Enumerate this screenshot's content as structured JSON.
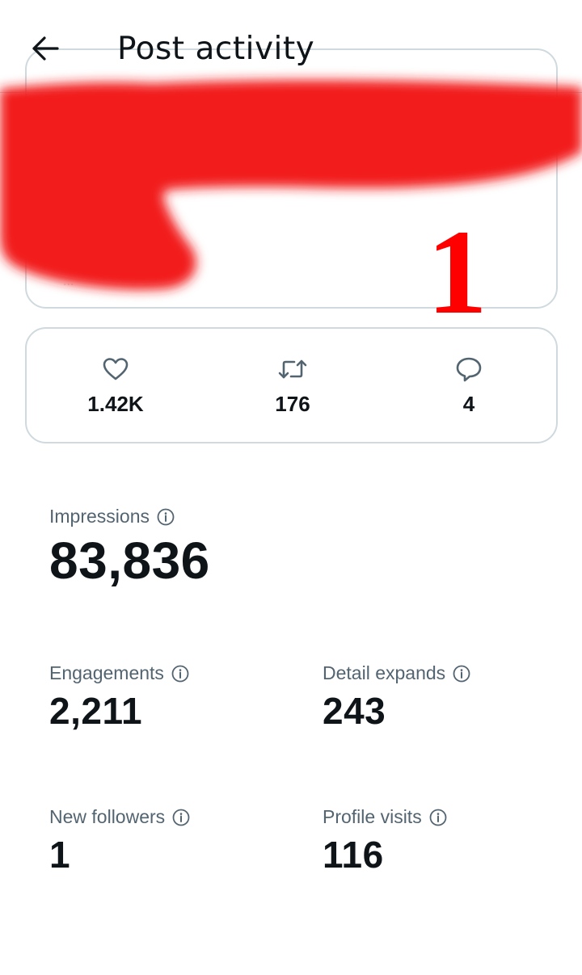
{
  "header": {
    "title": "Post activity",
    "back_icon": "arrow-left-icon"
  },
  "post_preview": {
    "ghost_text": "..."
  },
  "redaction": {
    "color": "#f21a1a",
    "label": "1"
  },
  "engagement_bar": {
    "likes": {
      "icon": "heart-icon",
      "value": "1.42K"
    },
    "reposts": {
      "icon": "repost-icon",
      "value": "176"
    },
    "replies": {
      "icon": "reply-icon",
      "value": "4"
    }
  },
  "metrics": {
    "impressions": {
      "label": "Impressions",
      "value": "83,836"
    },
    "engagements": {
      "label": "Engagements",
      "value": "2,211"
    },
    "detail_expands": {
      "label": "Detail expands",
      "value": "243"
    },
    "new_followers": {
      "label": "New followers",
      "value": "1"
    },
    "profile_visits": {
      "label": "Profile visits",
      "value": "116"
    }
  },
  "colors": {
    "text_primary": "#0f1419",
    "text_secondary": "#536471",
    "border": "#cfd9de"
  }
}
